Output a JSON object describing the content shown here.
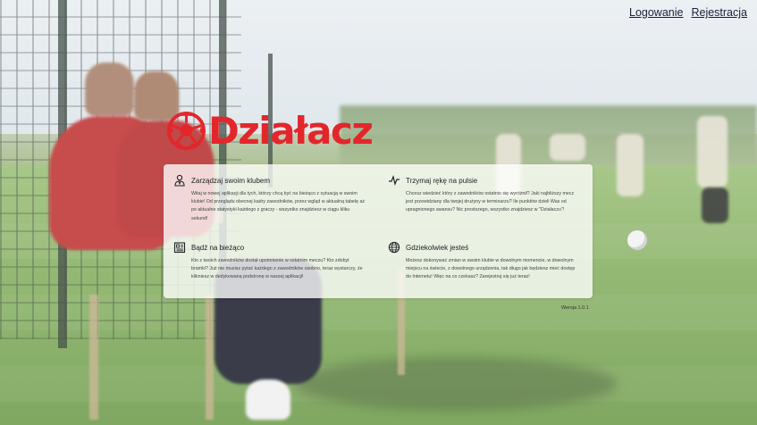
{
  "nav": {
    "login": "Logowanie",
    "register": "Rejestracja"
  },
  "brand": {
    "name": "Działacz",
    "accent": "#e3262b"
  },
  "features": [
    {
      "icon": "manager-icon",
      "title": "Zarządzaj swoim klubem",
      "text": "Witaj w nowej aplikacji dla tych, którzy chcą być na bieżąco z sytuacją w swoim klubie! Od przeglądu obecnej kadry zawodników, przez wgląd w aktualną tabelę aż po aktualne statystyki każdego z graczy - wszystko znajdziesz w ciągu kliku sekund!"
    },
    {
      "icon": "pulse-icon",
      "title": "Trzymaj rękę na pulsie",
      "text": "Chcesz wiedzieć który z zawodników ostatnio się wyróżnił? Jaki najbliższy mecz jest przewidziany dla twojej drużyny w terminarzu? Ile punktów dzieli Was od upragnionego awansu? Nic prostszego, wszystko znajdziesz w \"Działaczu\"!"
    },
    {
      "icon": "news-icon",
      "title": "Bądź na bieżąco",
      "text": "Kto z twoich zawodników dostał upomnienie w ostatnim meczu? Kto zdobył bramki? Już nie musisz pytać każdego z zawodników osobno, teraz wystarczy, że klikniesz w dedykowaną podstronę w naszej aplikacji!"
    },
    {
      "icon": "globe-icon",
      "title": "Gdziekolwiek jesteś",
      "text": "Możesz dokonywać zmian w swoim klubie w dowolnym momencie, w dowolnym miejscu na świecie, z dowolnego urządzenia, tak długo jak będziesz mieć dostęp do Internetu! Więc na co czekasz? Zarejestruj się już teraz!"
    }
  ],
  "footer": {
    "version": "Wersja 1.0.1"
  }
}
